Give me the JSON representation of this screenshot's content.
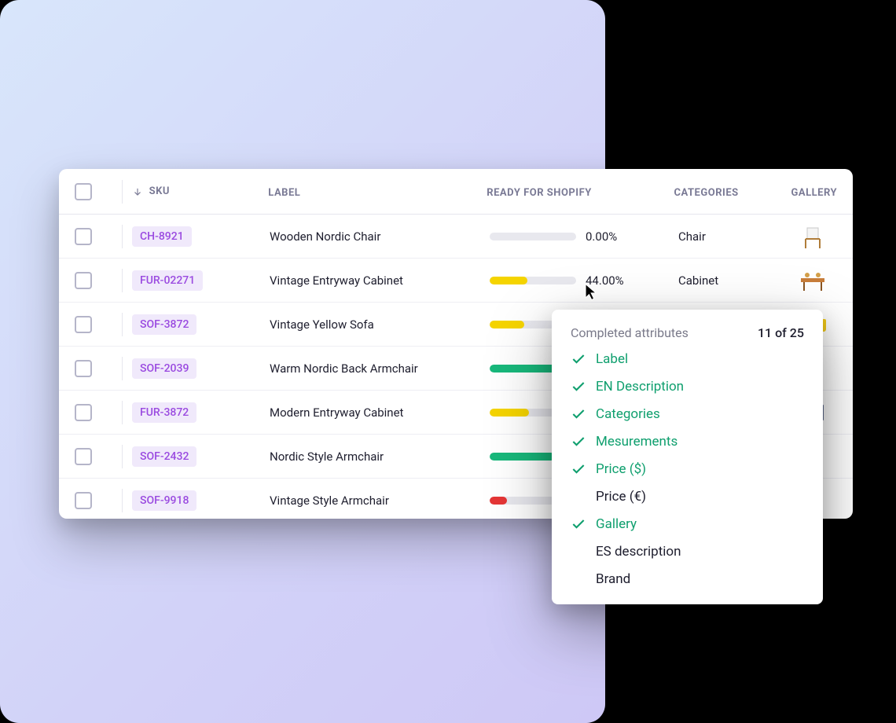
{
  "headers": {
    "sku": "SKU",
    "label": "LABEL",
    "ready": "READY FOR SHOPIFY",
    "categories": "CATEGORIES",
    "gallery": "GALLERY"
  },
  "rows": [
    {
      "sku": "CH-8921",
      "label": "Wooden Nordic Chair",
      "pct": "0.00%",
      "pctVal": 0,
      "barColor": "#e8e8ee",
      "cat": "Chair",
      "icon": "chair"
    },
    {
      "sku": "FUR-02271",
      "label": "Vintage Entryway Cabinet",
      "pct": "44.00%",
      "pctVal": 44,
      "barColor": "#f5d400",
      "cat": "Cabinet",
      "icon": "table"
    },
    {
      "sku": "SOF-3872",
      "label": "Vintage Yellow Sofa",
      "pct": "",
      "pctVal": 40,
      "barColor": "#f5d400",
      "cat": "",
      "icon": "sofa"
    },
    {
      "sku": "SOF-2039",
      "label": "Warm Nordic Back Armchair",
      "pct": "",
      "pctVal": 80,
      "barColor": "#18b87b",
      "cat": "",
      "icon": "armchair-dark"
    },
    {
      "sku": "FUR-3872",
      "label": "Modern Entryway Cabinet",
      "pct": "",
      "pctVal": 45,
      "barColor": "#f5d400",
      "cat": "",
      "icon": "cabinet"
    },
    {
      "sku": "SOF-2432",
      "label": "Nordic Style Armchair",
      "pct": "",
      "pctVal": 75,
      "barColor": "#18b87b",
      "cat": "",
      "icon": "armchair-blue"
    },
    {
      "sku": "SOF-9918",
      "label": "Vintage Style Armchair",
      "pct": "",
      "pctVal": 20,
      "barColor": "#e53535",
      "cat": "",
      "icon": "armchair-brown"
    }
  ],
  "popover": {
    "title": "Completed attributes",
    "count": "11 of 25",
    "items": [
      {
        "label": "Label",
        "done": true
      },
      {
        "label": "EN Description",
        "done": true
      },
      {
        "label": "Categories",
        "done": true
      },
      {
        "label": "Mesurements",
        "done": true
      },
      {
        "label": "Price ($)",
        "done": true
      },
      {
        "label": "Price (€)",
        "done": false
      },
      {
        "label": "Gallery",
        "done": true
      },
      {
        "label": "ES description",
        "done": false
      },
      {
        "label": "Brand",
        "done": false
      }
    ]
  }
}
